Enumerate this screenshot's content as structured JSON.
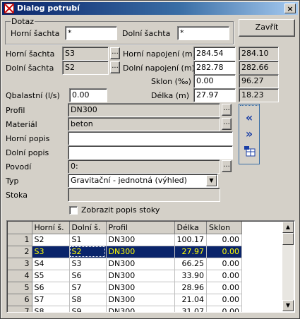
{
  "window": {
    "title": "Dialog potrubí",
    "close_glyph": "×"
  },
  "query": {
    "group_label": "Dotaz",
    "upper_label": "Horní šachta",
    "upper_value": "*",
    "lower_label": "Dolní šachta",
    "lower_value": "*"
  },
  "close_button_label": "Zavřít",
  "form": {
    "upper_shaft_label": "Horní šachta",
    "upper_shaft_value": "S3",
    "lower_shaft_label": "Dolní šachta",
    "lower_shaft_value": "S2",
    "upper_conn_label": "Horní napojení (m)",
    "upper_conn_value": "284.54",
    "upper_conn_calc": "284.10",
    "lower_conn_label": "Dolní napojení (m)",
    "lower_conn_value": "282.78",
    "lower_conn_calc": "282.66",
    "slope_label": "Sklon (‰)",
    "slope_value": "0.00",
    "slope_calc": "96.27",
    "rain_label": "Qbalastní (l/s)",
    "rain_value": "0.00",
    "length_label": "Délka (m)",
    "length_value": "27.97",
    "length_calc": "18.23",
    "profile_label": "Profil",
    "profile_value": "DN300",
    "material_label": "Materiál",
    "material_value": "beton",
    "upper_desc_label": "Horní popis",
    "upper_desc_value": "",
    "lower_desc_label": "Dolní popis",
    "lower_desc_value": "",
    "basin_label": "Povodí",
    "basin_value": "0:",
    "type_label": "Typ",
    "type_value": "Gravitační - jednotná (výhled)",
    "sewer_label": "Stoka",
    "sewer_value": "",
    "show_desc_label": "Zobrazit popis stoky",
    "ellipsis": "..."
  },
  "nav": {
    "prev_glyph": "«",
    "next_glyph": "»"
  },
  "table": {
    "columns": [
      "Horní š.",
      "Dolní š.",
      "Profil",
      "Délka",
      "Sklon"
    ],
    "rows": [
      {
        "n": "1",
        "upper": "S2",
        "lower": "S1",
        "profile": "DN300",
        "length": "100.17",
        "slope": "0.00"
      },
      {
        "n": "2",
        "upper": "S3",
        "lower": "S2",
        "profile": "DN300",
        "length": "27.97",
        "slope": "0.00"
      },
      {
        "n": "3",
        "upper": "S4",
        "lower": "S3",
        "profile": "DN300",
        "length": "66.25",
        "slope": "0.00"
      },
      {
        "n": "4",
        "upper": "S5",
        "lower": "S6",
        "profile": "DN300",
        "length": "33.90",
        "slope": "0.00"
      },
      {
        "n": "5",
        "upper": "S6",
        "lower": "S7",
        "profile": "DN300",
        "length": "28.96",
        "slope": "0.00"
      },
      {
        "n": "6",
        "upper": "S7",
        "lower": "S8",
        "profile": "DN300",
        "length": "21.04",
        "slope": "0.00"
      },
      {
        "n": "7",
        "upper": "S8",
        "lower": "S9",
        "profile": "DN300",
        "length": "31.07",
        "slope": "0.00"
      }
    ],
    "selected_index": 1
  },
  "colors": {
    "selection_bg": "#0a246a",
    "selection_fg": "#ffff00",
    "face": "#d4d0c8"
  }
}
